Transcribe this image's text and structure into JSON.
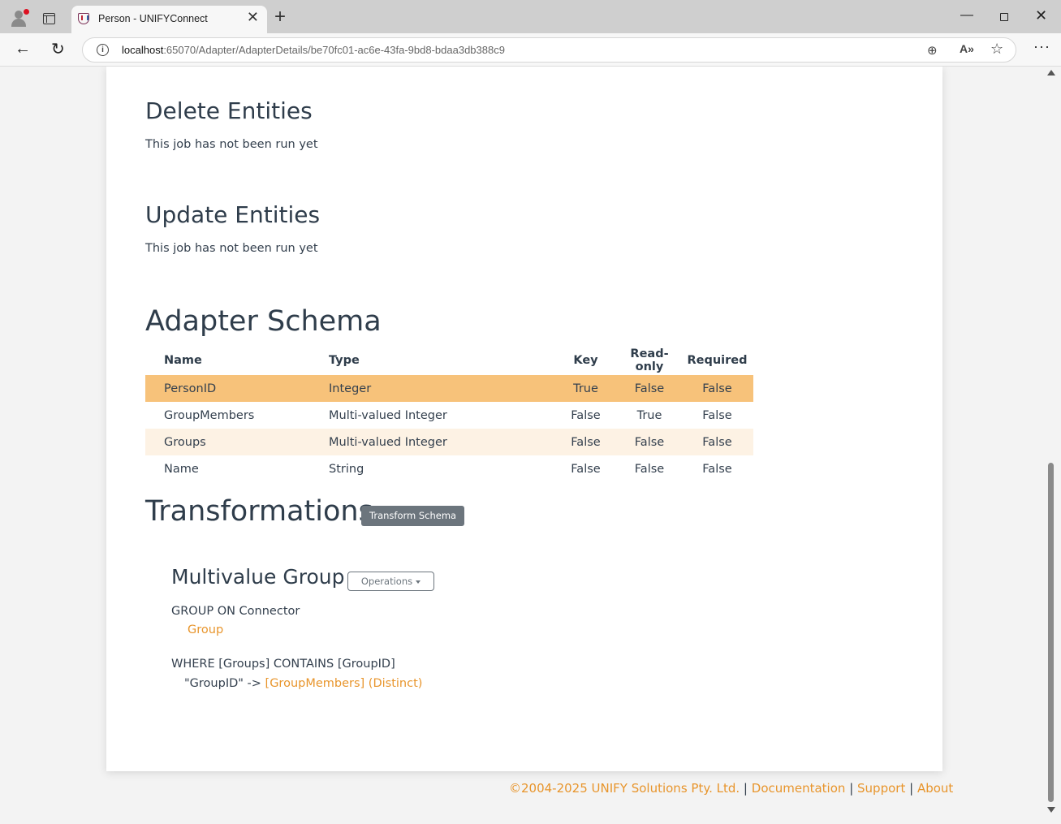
{
  "browser": {
    "tab_title": "Person - UNIFYConnect",
    "url_host": "localhost",
    "url_path": ":65070/Adapter/AdapterDetails/be70fc01-ac6e-43fa-9bd8-bdaa3db388c9"
  },
  "delete_section": {
    "title": "Delete Entities",
    "status": "This job has not been run yet"
  },
  "update_section": {
    "title": "Update Entities",
    "status": "This job has not been run yet"
  },
  "schema": {
    "title": "Adapter Schema",
    "headers": [
      "Name",
      "Type",
      "Key",
      "Read-only",
      "Required"
    ],
    "rows": [
      {
        "name": "PersonID",
        "type": "Integer",
        "key": "True",
        "readonly": "False",
        "required": "False"
      },
      {
        "name": "GroupMembers",
        "type": "Multi-valued Integer",
        "key": "False",
        "readonly": "True",
        "required": "False"
      },
      {
        "name": "Groups",
        "type": "Multi-valued Integer",
        "key": "False",
        "readonly": "False",
        "required": "False"
      },
      {
        "name": "Name",
        "type": "String",
        "key": "False",
        "readonly": "False",
        "required": "False"
      }
    ]
  },
  "transformations": {
    "title": "Transformations",
    "transform_button": "Transform Schema",
    "group": {
      "title": "Multivalue Group",
      "operations_button": "Operations",
      "group_on": "GROUP ON Connector",
      "group_link": "Group",
      "where": "WHERE [Groups] CONTAINS [GroupID]",
      "mapping_prefix": "\"GroupID\" ->",
      "mapping_target": "[GroupMembers] (Distinct)"
    }
  },
  "footer": {
    "copyright": "©2004-2025 UNIFY Solutions Pty. Ltd.",
    "sep": "|",
    "documentation": "Documentation",
    "support": "Support",
    "about": "About"
  },
  "colors": {
    "accent": "#e8952c",
    "selected_row": "#f7c27a",
    "alt_row": "#fdf2e4",
    "button_gray": "#6c757d"
  }
}
